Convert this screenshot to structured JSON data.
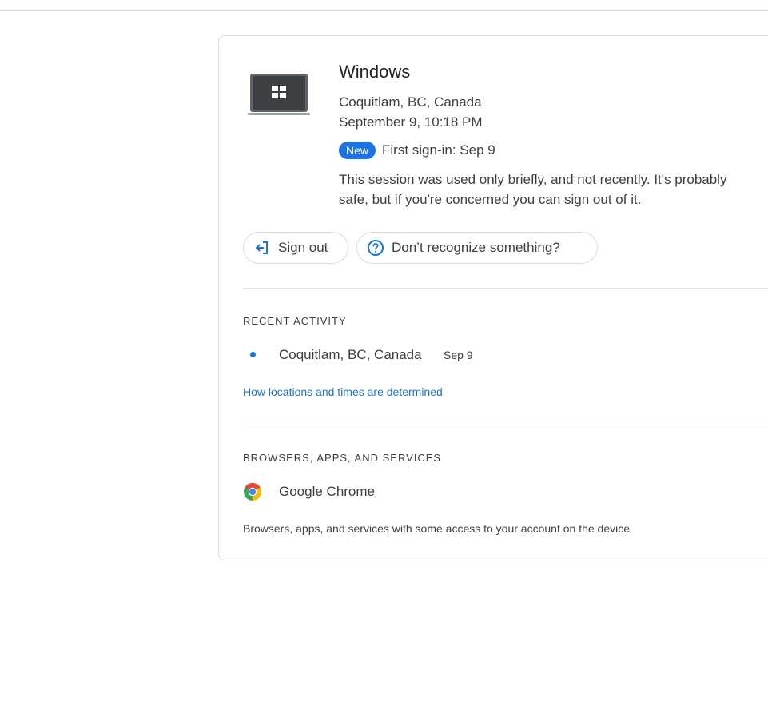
{
  "device": {
    "icon": "windows-laptop-icon",
    "title": "Windows",
    "location": "Coquitlam, BC, Canada",
    "time": "September 9, 10:18 PM",
    "badge": "New",
    "first_signin": "First sign-in: Sep 9",
    "description": "This session was used only briefly, and not recently. It's probably safe, but if you're concerned you can sign out of it."
  },
  "actions": {
    "sign_out": {
      "label": "Sign out",
      "icon": "sign-out-icon"
    },
    "recognize": {
      "label": "Don’t recognize something?",
      "icon": "help-circle-icon"
    }
  },
  "recent_activity": {
    "heading": "RECENT ACTIVITY",
    "items": [
      {
        "location": "Coquitlam, BC, Canada",
        "date": "Sep 9"
      }
    ],
    "link": "How locations and times are determined"
  },
  "services": {
    "heading": "BROWSERS, APPS, AND SERVICES",
    "items": [
      {
        "name": "Google Chrome",
        "icon": "chrome-icon"
      }
    ],
    "note": "Browsers, apps, and services with some access to your account on the device"
  },
  "colors": {
    "accent": "#1a73e8",
    "border": "#dadce0",
    "text": "#3c4043"
  }
}
